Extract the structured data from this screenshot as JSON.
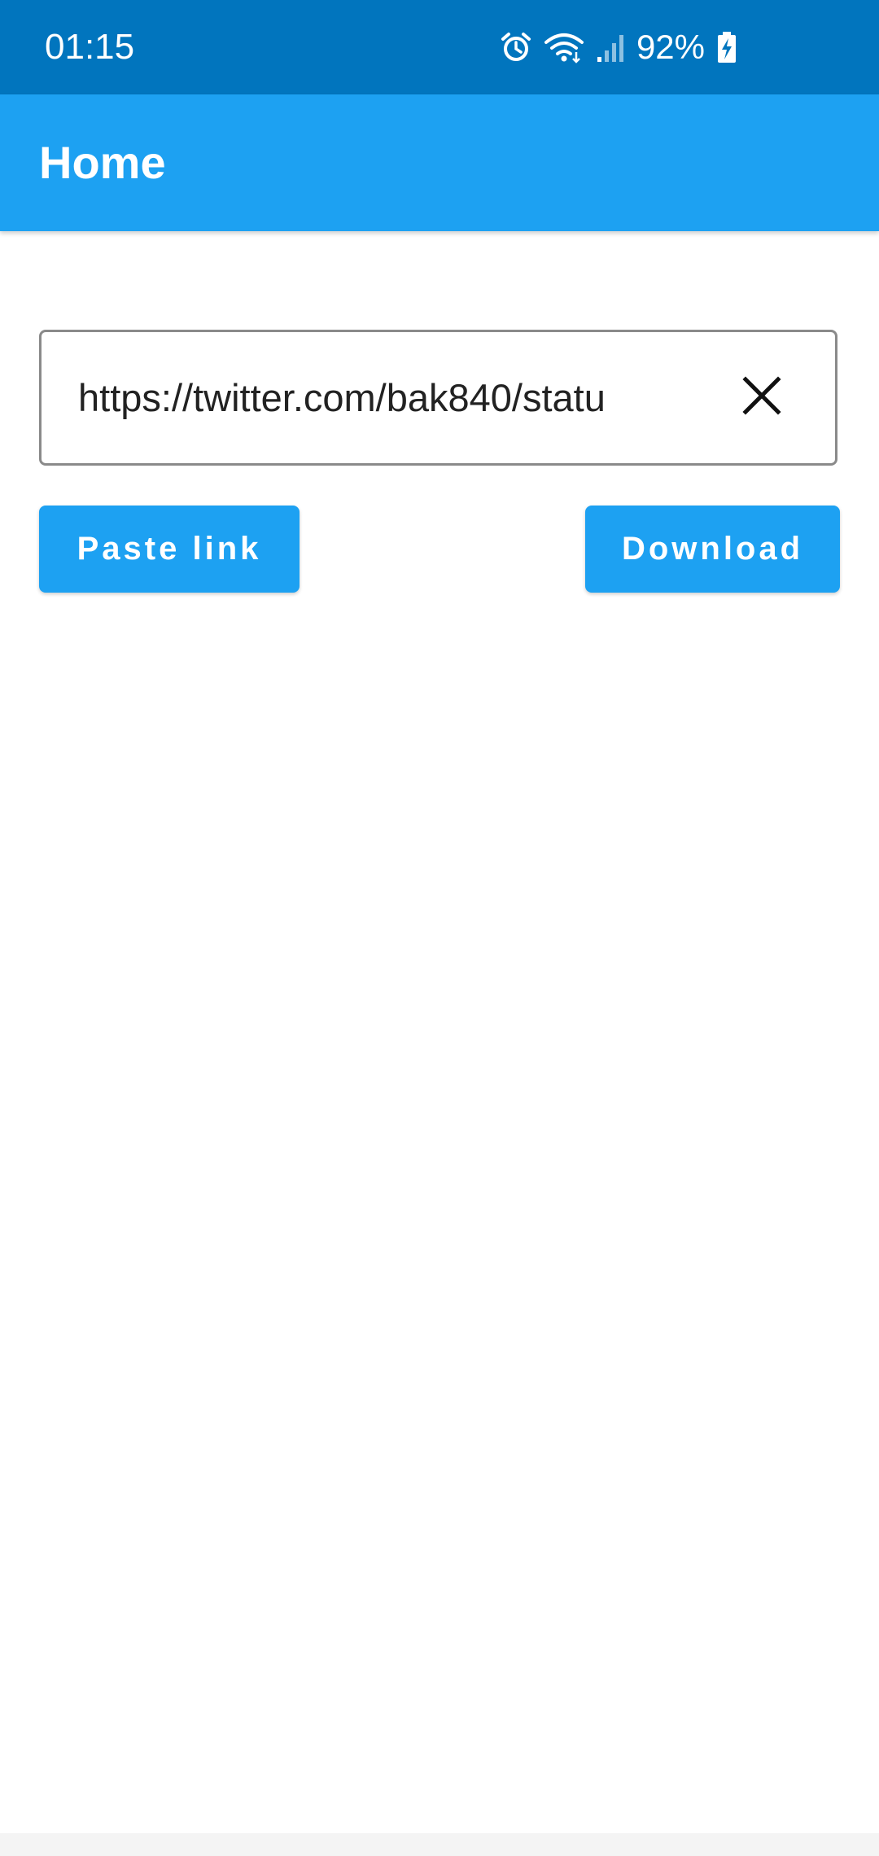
{
  "status_bar": {
    "time": "01:15",
    "battery": "92%",
    "icons": [
      "alarm-icon",
      "wifi-icon",
      "signal-icon",
      "battery-charging-icon"
    ]
  },
  "app_bar": {
    "title": "Home"
  },
  "url_field": {
    "value": "https://twitter.com/bak840/statu",
    "clear_icon": "close-icon"
  },
  "buttons": {
    "paste_label": "Paste link",
    "download_label": "Download"
  },
  "colors": {
    "status_bar": "#0175BE",
    "accent": "#1DA1F2",
    "text": "#222222"
  }
}
